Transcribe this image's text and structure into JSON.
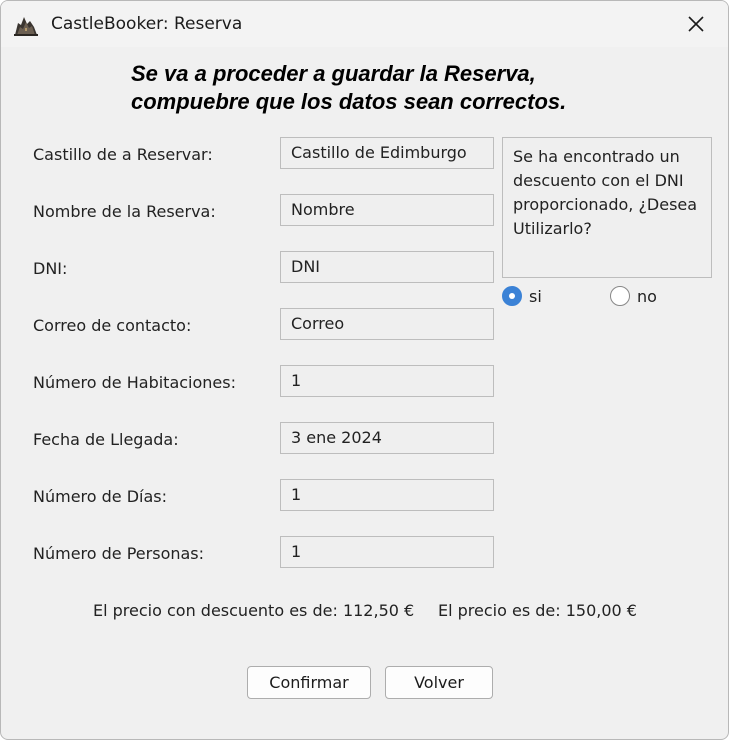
{
  "window": {
    "title": "CastleBooker: Reserva",
    "app_icon": "castle-icon",
    "close_icon": "close-icon"
  },
  "heading": {
    "line1": "Se va a proceder a guardar la Reserva,",
    "line2": "compuebre que los datos sean correctos."
  },
  "form": {
    "fields": [
      {
        "label": "Castillo de a Reservar:",
        "value": "Castillo de Edimburgo"
      },
      {
        "label": "Nombre de la Reserva:",
        "value": "Nombre"
      },
      {
        "label": "DNI:",
        "value": "DNI"
      },
      {
        "label": "Correo de contacto:",
        "value": "Correo"
      },
      {
        "label": "Número de Habitaciones:",
        "value": "1"
      },
      {
        "label": "Fecha de Llegada:",
        "value": "3 ene 2024"
      },
      {
        "label": "Número de Días:",
        "value": "1"
      },
      {
        "label": "Número de Personas:",
        "value": "1"
      }
    ]
  },
  "discount": {
    "message": "Se ha encontrado un descuento con el DNI proporcionado, ¿Desea Utilizarlo?",
    "options": [
      {
        "label": "si",
        "selected": true
      },
      {
        "label": "no",
        "selected": false
      }
    ],
    "accent_color": "#3b82d6"
  },
  "prices": {
    "discounted": "El precio con descuento es de: 112,50 €",
    "regular": "El precio es de: 150,00 €"
  },
  "buttons": {
    "confirm": "Confirmar",
    "back": "Volver"
  }
}
